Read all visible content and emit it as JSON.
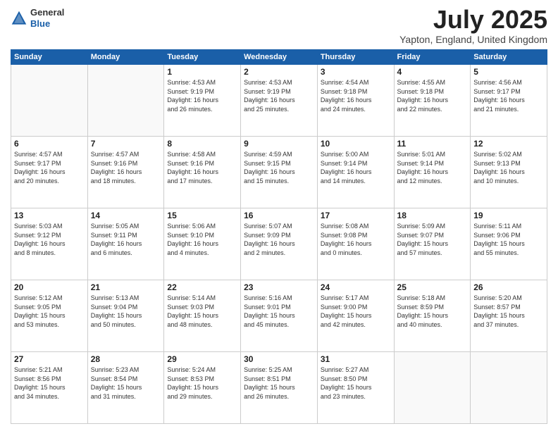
{
  "header": {
    "logo_line1": "General",
    "logo_line2": "Blue",
    "month": "July 2025",
    "location": "Yapton, England, United Kingdom"
  },
  "weekdays": [
    "Sunday",
    "Monday",
    "Tuesday",
    "Wednesday",
    "Thursday",
    "Friday",
    "Saturday"
  ],
  "weeks": [
    [
      {
        "day": "",
        "info": ""
      },
      {
        "day": "",
        "info": ""
      },
      {
        "day": "1",
        "info": "Sunrise: 4:53 AM\nSunset: 9:19 PM\nDaylight: 16 hours\nand 26 minutes."
      },
      {
        "day": "2",
        "info": "Sunrise: 4:53 AM\nSunset: 9:19 PM\nDaylight: 16 hours\nand 25 minutes."
      },
      {
        "day": "3",
        "info": "Sunrise: 4:54 AM\nSunset: 9:18 PM\nDaylight: 16 hours\nand 24 minutes."
      },
      {
        "day": "4",
        "info": "Sunrise: 4:55 AM\nSunset: 9:18 PM\nDaylight: 16 hours\nand 22 minutes."
      },
      {
        "day": "5",
        "info": "Sunrise: 4:56 AM\nSunset: 9:17 PM\nDaylight: 16 hours\nand 21 minutes."
      }
    ],
    [
      {
        "day": "6",
        "info": "Sunrise: 4:57 AM\nSunset: 9:17 PM\nDaylight: 16 hours\nand 20 minutes."
      },
      {
        "day": "7",
        "info": "Sunrise: 4:57 AM\nSunset: 9:16 PM\nDaylight: 16 hours\nand 18 minutes."
      },
      {
        "day": "8",
        "info": "Sunrise: 4:58 AM\nSunset: 9:16 PM\nDaylight: 16 hours\nand 17 minutes."
      },
      {
        "day": "9",
        "info": "Sunrise: 4:59 AM\nSunset: 9:15 PM\nDaylight: 16 hours\nand 15 minutes."
      },
      {
        "day": "10",
        "info": "Sunrise: 5:00 AM\nSunset: 9:14 PM\nDaylight: 16 hours\nand 14 minutes."
      },
      {
        "day": "11",
        "info": "Sunrise: 5:01 AM\nSunset: 9:14 PM\nDaylight: 16 hours\nand 12 minutes."
      },
      {
        "day": "12",
        "info": "Sunrise: 5:02 AM\nSunset: 9:13 PM\nDaylight: 16 hours\nand 10 minutes."
      }
    ],
    [
      {
        "day": "13",
        "info": "Sunrise: 5:03 AM\nSunset: 9:12 PM\nDaylight: 16 hours\nand 8 minutes."
      },
      {
        "day": "14",
        "info": "Sunrise: 5:05 AM\nSunset: 9:11 PM\nDaylight: 16 hours\nand 6 minutes."
      },
      {
        "day": "15",
        "info": "Sunrise: 5:06 AM\nSunset: 9:10 PM\nDaylight: 16 hours\nand 4 minutes."
      },
      {
        "day": "16",
        "info": "Sunrise: 5:07 AM\nSunset: 9:09 PM\nDaylight: 16 hours\nand 2 minutes."
      },
      {
        "day": "17",
        "info": "Sunrise: 5:08 AM\nSunset: 9:08 PM\nDaylight: 16 hours\nand 0 minutes."
      },
      {
        "day": "18",
        "info": "Sunrise: 5:09 AM\nSunset: 9:07 PM\nDaylight: 15 hours\nand 57 minutes."
      },
      {
        "day": "19",
        "info": "Sunrise: 5:11 AM\nSunset: 9:06 PM\nDaylight: 15 hours\nand 55 minutes."
      }
    ],
    [
      {
        "day": "20",
        "info": "Sunrise: 5:12 AM\nSunset: 9:05 PM\nDaylight: 15 hours\nand 53 minutes."
      },
      {
        "day": "21",
        "info": "Sunrise: 5:13 AM\nSunset: 9:04 PM\nDaylight: 15 hours\nand 50 minutes."
      },
      {
        "day": "22",
        "info": "Sunrise: 5:14 AM\nSunset: 9:03 PM\nDaylight: 15 hours\nand 48 minutes."
      },
      {
        "day": "23",
        "info": "Sunrise: 5:16 AM\nSunset: 9:01 PM\nDaylight: 15 hours\nand 45 minutes."
      },
      {
        "day": "24",
        "info": "Sunrise: 5:17 AM\nSunset: 9:00 PM\nDaylight: 15 hours\nand 42 minutes."
      },
      {
        "day": "25",
        "info": "Sunrise: 5:18 AM\nSunset: 8:59 PM\nDaylight: 15 hours\nand 40 minutes."
      },
      {
        "day": "26",
        "info": "Sunrise: 5:20 AM\nSunset: 8:57 PM\nDaylight: 15 hours\nand 37 minutes."
      }
    ],
    [
      {
        "day": "27",
        "info": "Sunrise: 5:21 AM\nSunset: 8:56 PM\nDaylight: 15 hours\nand 34 minutes."
      },
      {
        "day": "28",
        "info": "Sunrise: 5:23 AM\nSunset: 8:54 PM\nDaylight: 15 hours\nand 31 minutes."
      },
      {
        "day": "29",
        "info": "Sunrise: 5:24 AM\nSunset: 8:53 PM\nDaylight: 15 hours\nand 29 minutes."
      },
      {
        "day": "30",
        "info": "Sunrise: 5:25 AM\nSunset: 8:51 PM\nDaylight: 15 hours\nand 26 minutes."
      },
      {
        "day": "31",
        "info": "Sunrise: 5:27 AM\nSunset: 8:50 PM\nDaylight: 15 hours\nand 23 minutes."
      },
      {
        "day": "",
        "info": ""
      },
      {
        "day": "",
        "info": ""
      }
    ]
  ]
}
